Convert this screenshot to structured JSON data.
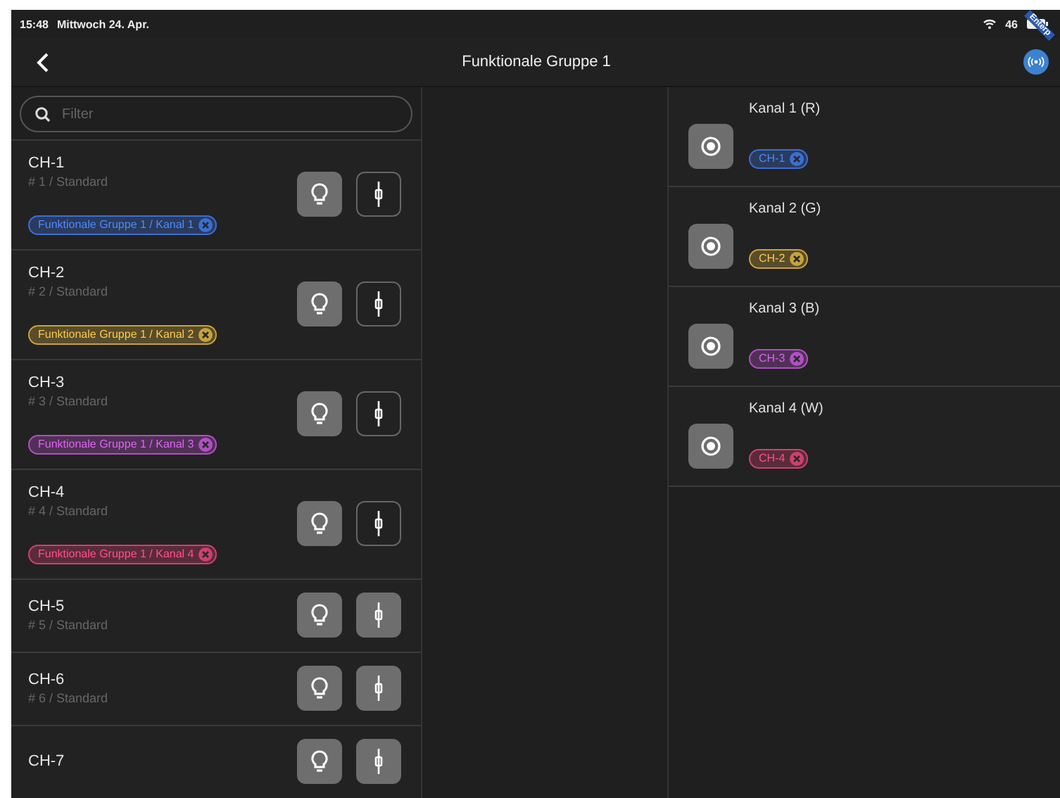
{
  "status_bar": {
    "time": "15:48",
    "date": "Mittwoch 24. Apr.",
    "battery": "46",
    "ribbon": "Enterp"
  },
  "nav": {
    "title": "Funktionale Gruppe 1"
  },
  "filter": {
    "placeholder": "Filter"
  },
  "channels": [
    {
      "name": "CH-1",
      "info": "# 1 / Standard",
      "tag": {
        "label": "Funktionale Gruppe 1 / Kanal 1",
        "color": "#3b6fd4"
      },
      "bulb_on": true,
      "plug_on": false
    },
    {
      "name": "CH-2",
      "info": "# 2 / Standard",
      "tag": {
        "label": "Funktionale Gruppe 1 / Kanal 2",
        "color": "#c8a23c"
      },
      "bulb_on": true,
      "plug_on": false
    },
    {
      "name": "CH-3",
      "info": "# 3 / Standard",
      "tag": {
        "label": "Funktionale Gruppe 1 / Kanal 3",
        "color": "#b24fc4"
      },
      "bulb_on": true,
      "plug_on": false
    },
    {
      "name": "CH-4",
      "info": "# 4 / Standard",
      "tag": {
        "label": "Funktionale Gruppe 1 / Kanal 4",
        "color": "#d0406e"
      },
      "bulb_on": true,
      "plug_on": false
    },
    {
      "name": "CH-5",
      "info": "# 5 / Standard",
      "bulb_on": true,
      "plug_on": true
    },
    {
      "name": "CH-6",
      "info": "# 6 / Standard",
      "bulb_on": true,
      "plug_on": true
    },
    {
      "name": "CH-7",
      "bulb_on": true,
      "plug_on": true
    }
  ],
  "kanals": [
    {
      "name": "Kanal 1 (R)",
      "tag": {
        "label": "CH-1",
        "color": "#3b6fd4"
      }
    },
    {
      "name": "Kanal 2 (G)",
      "tag": {
        "label": "CH-2",
        "color": "#c8a23c"
      }
    },
    {
      "name": "Kanal 3 (B)",
      "tag": {
        "label": "CH-3",
        "color": "#b24fc4"
      }
    },
    {
      "name": "Kanal 4 (W)",
      "tag": {
        "label": "CH-4",
        "color": "#d0406e"
      }
    }
  ]
}
